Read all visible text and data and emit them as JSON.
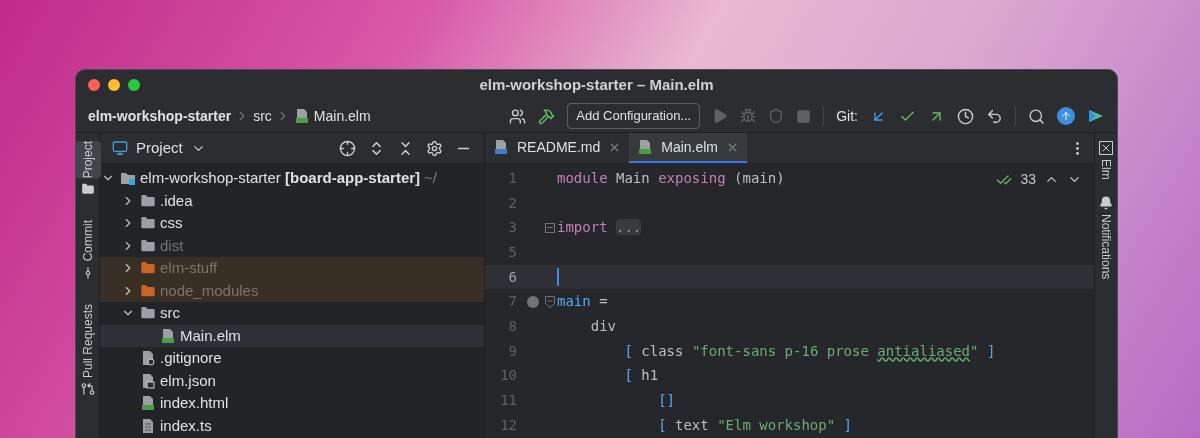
{
  "window": {
    "title": "elm-workshop-starter – Main.elm"
  },
  "toolbar": {
    "breadcrumbs": [
      {
        "label": "elm-workshop-starter",
        "kind": "project"
      },
      {
        "label": "src",
        "kind": "folder"
      },
      {
        "label": "Main.elm",
        "kind": "elm"
      }
    ],
    "run_configuration": "Add Configuration...",
    "run_actions_disabled": true,
    "git_label": "Git:"
  },
  "left_tool_tabs": [
    {
      "label": "Project",
      "kind": "folder",
      "selected": true
    },
    {
      "label": "Commit",
      "kind": "commit",
      "selected": false
    },
    {
      "label": "Pull Requests",
      "kind": "pull",
      "selected": false
    }
  ],
  "project_panel": {
    "title": "Project",
    "tree": [
      {
        "label": "elm-workshop-starter **[board-app-starter]**",
        "path": "~/",
        "kind": "project",
        "expanded": true,
        "selected": false,
        "excluded": false,
        "ignored": false,
        "children": [
          {
            "label": ".idea",
            "kind": "folder",
            "expanded": false,
            "selected": false,
            "excluded": false,
            "ignored": false
          },
          {
            "label": "css",
            "kind": "folder",
            "expanded": false,
            "selected": false,
            "excluded": false,
            "ignored": false
          },
          {
            "label": "dist",
            "kind": "folder",
            "expanded": false,
            "selected": false,
            "excluded": true,
            "ignored": false
          },
          {
            "label": "elm-stuff",
            "kind": "folder",
            "expanded": false,
            "selected": false,
            "excluded": false,
            "ignored": true
          },
          {
            "label": "node_modules",
            "kind": "folder",
            "expanded": false,
            "selected": false,
            "excluded": false,
            "ignored": true
          },
          {
            "label": "src",
            "kind": "folder",
            "expanded": true,
            "selected": false,
            "excluded": false,
            "ignored": false,
            "children": [
              {
                "label": "Main.elm",
                "kind": "elm",
                "selected": true,
                "excluded": false,
                "ignored": false
              }
            ]
          },
          {
            "label": ".gitignore",
            "kind": "gitignore",
            "selected": false,
            "excluded": false,
            "ignored": false
          },
          {
            "label": "elm.json",
            "kind": "json",
            "selected": false,
            "excluded": false,
            "ignored": false
          },
          {
            "label": "index.html",
            "kind": "html",
            "selected": false,
            "excluded": false,
            "ignored": false
          },
          {
            "label": "index.ts",
            "kind": "ts",
            "selected": false,
            "excluded": false,
            "ignored": false
          }
        ]
      }
    ]
  },
  "editor": {
    "tabs": [
      {
        "label": "README.md",
        "kind": "md",
        "selected": false
      },
      {
        "label": "Main.elm",
        "kind": "elm",
        "selected": true
      }
    ],
    "problems_count": "33",
    "lines": [
      {
        "number": "1",
        "current": false,
        "run_marker": false,
        "tokens": [
          {
            "text": "module",
            "kind": "keyword"
          },
          {
            "text": " Main ",
            "kind": "plain"
          },
          {
            "text": "exposing",
            "kind": "keyword"
          },
          {
            "text": " (main)",
            "kind": "plain"
          }
        ]
      },
      {
        "number": "2",
        "current": false,
        "run_marker": false
      },
      {
        "number": "3",
        "current": false,
        "collapsed": true,
        "run_marker": false,
        "tokens": [
          {
            "text": "import ",
            "kind": "keyword"
          },
          {
            "text": "...",
            "kind": "folded"
          }
        ]
      },
      {
        "number": "5",
        "current": false,
        "run_marker": false
      },
      {
        "number": "6",
        "current": true,
        "run_marker": false
      },
      {
        "number": "7",
        "current": false,
        "collapsed": false,
        "run_marker": true,
        "tokens": [
          {
            "text": "main",
            "kind": "function"
          },
          {
            "text": " =",
            "kind": "plain"
          }
        ]
      },
      {
        "number": "8",
        "current": false,
        "run_marker": false,
        "tokens": [
          {
            "text": "    div",
            "kind": "plain"
          }
        ]
      },
      {
        "number": "9",
        "current": false,
        "run_marker": false,
        "tokens": [
          {
            "text": "        [",
            "kind": "bracket"
          },
          {
            "text": " class ",
            "kind": "plain"
          },
          {
            "text": "\"font-sans p-16 prose ",
            "kind": "string"
          },
          {
            "text": "antialiased",
            "kind": "typo"
          },
          {
            "text": "\"",
            "kind": "string"
          },
          {
            "text": " ]",
            "kind": "bracket"
          }
        ]
      },
      {
        "number": "10",
        "current": false,
        "run_marker": false,
        "tokens": [
          {
            "text": "        [",
            "kind": "bracket"
          },
          {
            "text": " h1",
            "kind": "plain"
          }
        ]
      },
      {
        "number": "11",
        "current": false,
        "run_marker": false,
        "tokens": [
          {
            "text": "            []",
            "kind": "bracket"
          }
        ]
      },
      {
        "number": "12",
        "current": false,
        "run_marker": false,
        "tokens": [
          {
            "text": "            [",
            "kind": "bracket"
          },
          {
            "text": " text ",
            "kind": "plain"
          },
          {
            "text": "\"Elm workshop\"",
            "kind": "string"
          },
          {
            "text": " ]",
            "kind": "bracket"
          }
        ]
      }
    ]
  },
  "right_tool_tabs": [
    {
      "label": "Elm",
      "kind": "elm"
    },
    {
      "label": "Notifications",
      "kind": "bell"
    }
  ]
}
